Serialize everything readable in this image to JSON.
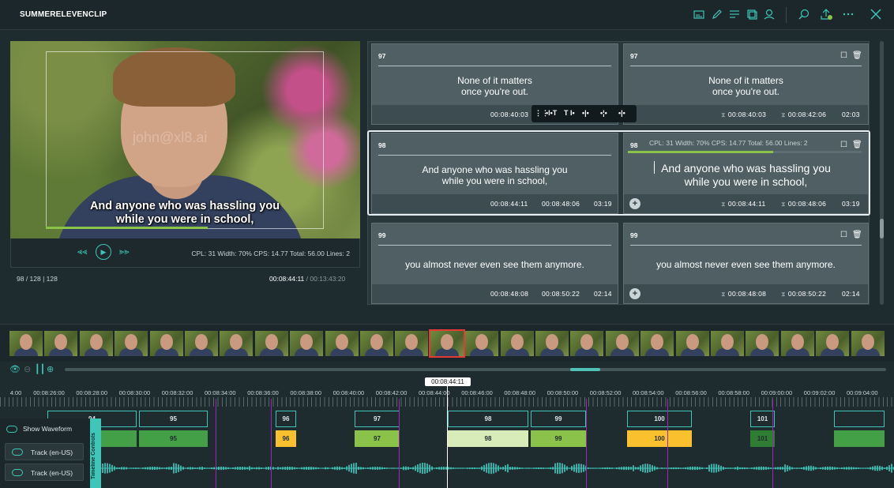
{
  "app": {
    "title": "SUMMERELEVENCLIP"
  },
  "toolbar": {
    "icons": [
      "subtitle-icon",
      "edit-icon",
      "list-icon",
      "copy-icon",
      "user-icon",
      "search-icon",
      "upload-icon",
      "more-icon",
      "close-icon"
    ]
  },
  "player": {
    "subtitle_line1": "And anyone who was hassling you",
    "subtitle_line2": "while you were in school,",
    "watermark": "john@xl8.ai",
    "stats": "CPL: 31   Width: 70%   CPS: 14.77   Total: 56.00   Lines: 2",
    "counter": "98 / 128 | 128",
    "current_time": "00:08:44:11",
    "total_time": "/ 00:13:43:20"
  },
  "subtitles": [
    {
      "num": "97",
      "src_line1": "None of it matters",
      "src_line2": "once you're out.",
      "tgt_line1": "None of it matters",
      "tgt_line2": "once you're out.",
      "src_in": "00:08:40:03",
      "src_out": "",
      "tgt_in": "00:08:40:03",
      "tgt_out": "00:08:42:06",
      "dur": "02:03"
    },
    {
      "num": "98",
      "src_line1": "And anyone who was hassling you",
      "src_line2": "while you were in school,",
      "tgt_line1": "And anyone who was hassling you",
      "tgt_line2": "while you were in school,",
      "src_in": "00:08:44:11",
      "src_out": "00:08:48:06",
      "tgt_in": "00:08:44:11",
      "tgt_out": "00:08:48:06",
      "dur": "03:19",
      "stats": "CPL: 31   Width: 70%   CPS: 14.77   Total: 56.00   Lines: 2"
    },
    {
      "num": "99",
      "src_line1": "you almost never even see them anymore.",
      "src_line2": "",
      "tgt_line1": "you almost never even see them anymore.",
      "tgt_line2": "",
      "src_in": "00:08:48:08",
      "src_out": "00:08:50:22",
      "tgt_in": "00:08:48:08",
      "tgt_out": "00:08:50:22",
      "dur": "02:14"
    }
  ],
  "float_toolbar": [
    "⋮⋮",
    "•I•T",
    "T I•",
    "•|•",
    "•¦•",
    "•|•"
  ],
  "timeline": {
    "playhead": "00:08:44:11",
    "ticks": [
      "4:00",
      "00:08:26:00",
      "00:08:28:00",
      "00:08:30:00",
      "00:08:32:00",
      "00:08:34:00",
      "00:08:36:00",
      "00:08:38:00",
      "00:08:40:00",
      "00:08:42:00",
      "00:08:44:00",
      "00:08:46:00",
      "00:08:48:00",
      "00:08:50:00",
      "00:08:52:00",
      "00:08:54:00",
      "00:08:56:00",
      "00:08:58:00",
      "00:09:00:00",
      "00:09:02:00",
      "00:09:04:00"
    ],
    "out_segments": [
      {
        "label": "94"
      },
      {
        "label": "95"
      },
      {
        "label": "96"
      },
      {
        "label": "97"
      },
      {
        "label": "98"
      },
      {
        "label": "99"
      },
      {
        "label": "100"
      },
      {
        "label": "101"
      },
      {
        "label": ""
      }
    ],
    "in_segments": [
      {
        "label": "",
        "color": "#43a047"
      },
      {
        "label": "95",
        "color": "#43a047"
      },
      {
        "label": "96",
        "color": "#fbc02d"
      },
      {
        "label": "97",
        "color": "#8bc34a"
      },
      {
        "label": "98",
        "color": "#d7ecb8"
      },
      {
        "label": "99",
        "color": "#8bc34a"
      },
      {
        "label": "100",
        "color": "#fbc02d"
      },
      {
        "label": "101",
        "color": "#2e7d32"
      },
      {
        "label": "",
        "color": "#43a047"
      }
    ]
  },
  "waveform_panel": {
    "show_waveform": "Show Waveform",
    "track1": "Track (en-US)",
    "track2": "Track (en-US)",
    "side_label": "Timeline Controls"
  }
}
